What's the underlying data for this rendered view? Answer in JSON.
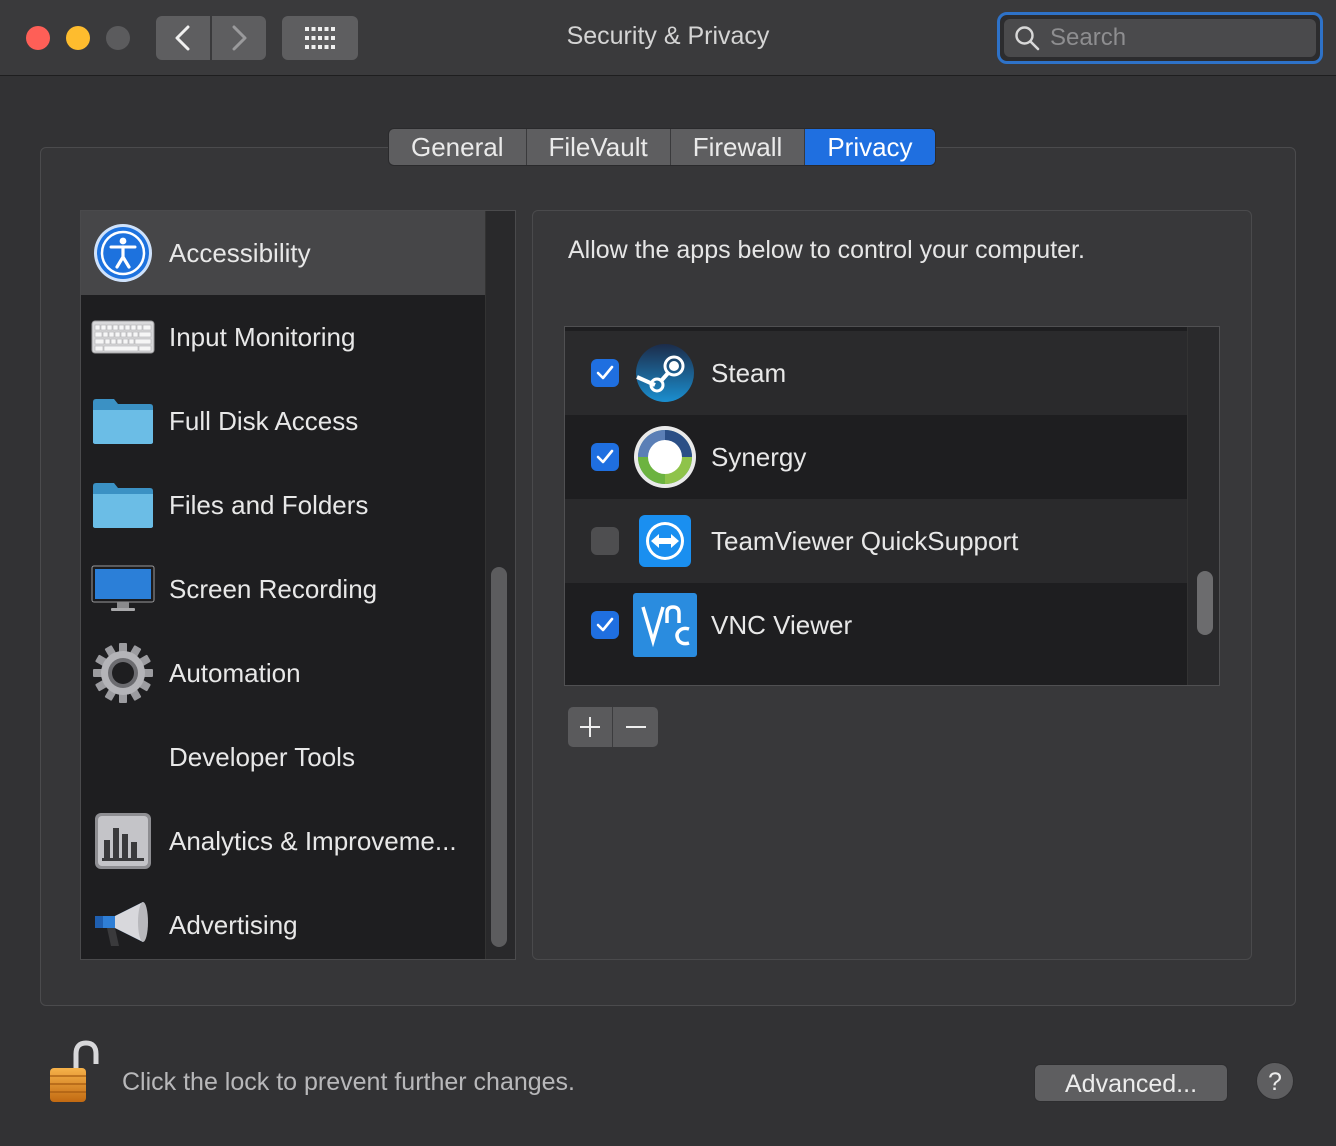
{
  "window": {
    "title": "Security & Privacy",
    "search_placeholder": "Search"
  },
  "tabs": [
    {
      "label": "General",
      "active": false
    },
    {
      "label": "FileVault",
      "active": false
    },
    {
      "label": "Firewall",
      "active": false
    },
    {
      "label": "Privacy",
      "active": true
    }
  ],
  "sidebar": {
    "items": [
      {
        "label": "Accessibility",
        "icon": "accessibility-icon",
        "selected": true
      },
      {
        "label": "Input Monitoring",
        "icon": "keyboard-icon"
      },
      {
        "label": "Full Disk Access",
        "icon": "folder-icon"
      },
      {
        "label": "Files and Folders",
        "icon": "folder-icon"
      },
      {
        "label": "Screen Recording",
        "icon": "display-icon"
      },
      {
        "label": "Automation",
        "icon": "gear-icon"
      },
      {
        "label": "Developer Tools",
        "icon": ""
      },
      {
        "label": "Analytics & Improveme...",
        "icon": "analytics-icon"
      },
      {
        "label": "Advertising",
        "icon": "megaphone-icon"
      }
    ]
  },
  "panel": {
    "description": "Allow the apps below to control your computer.",
    "apps": [
      {
        "name": "Steam",
        "checked": true,
        "icon": "steam-icon"
      },
      {
        "name": "Synergy",
        "checked": true,
        "icon": "synergy-icon"
      },
      {
        "name": "TeamViewer QuickSupport",
        "checked": false,
        "icon": "teamviewer-icon"
      },
      {
        "name": "VNC Viewer",
        "checked": true,
        "icon": "vnc-viewer-icon"
      }
    ]
  },
  "footer": {
    "lock_message": "Click the lock to prevent further changes.",
    "advanced_label": "Advanced...",
    "help_label": "?"
  },
  "colors": {
    "accent": "#1f6fe0",
    "window_bg": "#323234",
    "close": "#fe5f57",
    "minimize": "#febc2e"
  }
}
